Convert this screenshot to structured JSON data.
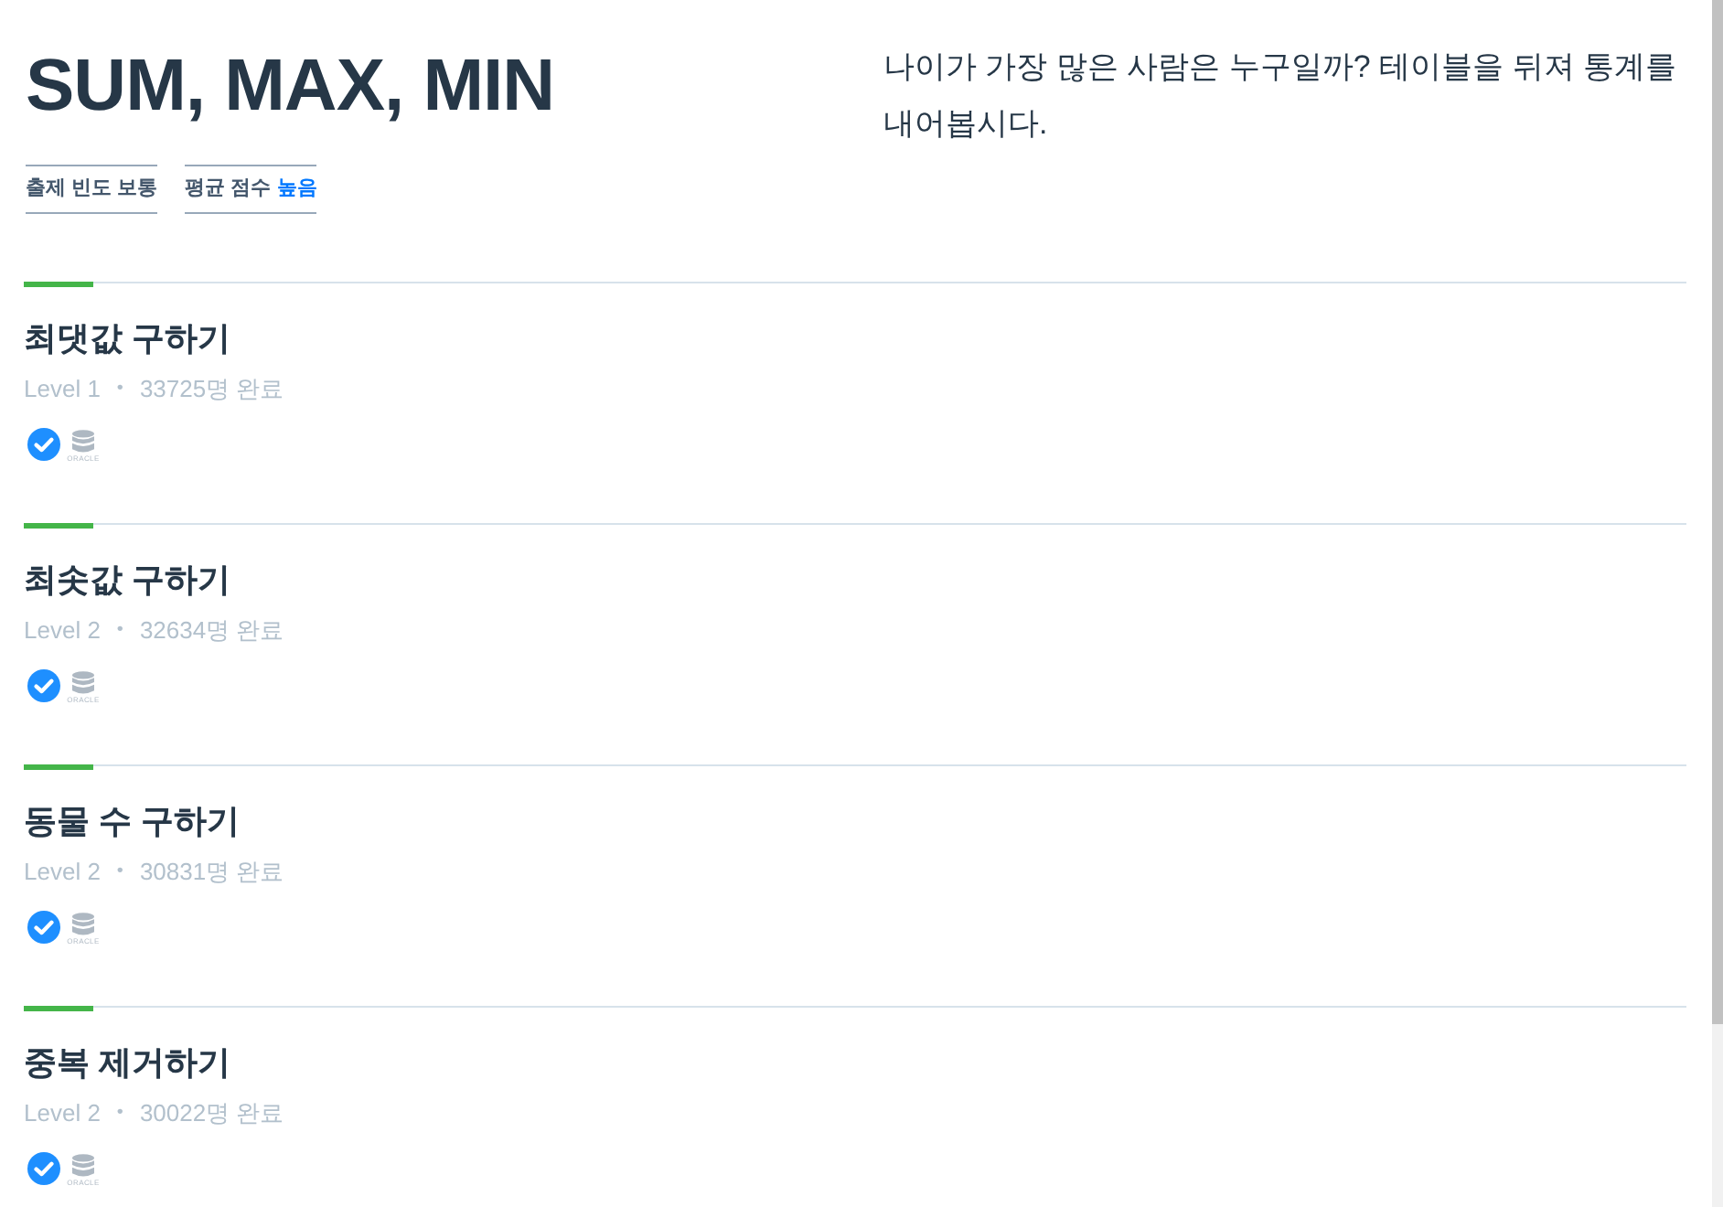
{
  "header": {
    "title": "SUM, MAX, MIN",
    "tags": [
      {
        "label": "출제 빈도",
        "value": "보통",
        "highlight": false
      },
      {
        "label": "평균 점수",
        "value": "높음",
        "highlight": true
      }
    ],
    "description": "나이가 가장 많은 사람은 누구일까? 테이블을 뒤져 통계를 내어봅시다."
  },
  "problems": [
    {
      "title": "최댓값 구하기",
      "level": "Level 1",
      "separator": "•",
      "completed": "33725명 완료",
      "solved": true,
      "db_label": "ORACLE"
    },
    {
      "title": "최솟값 구하기",
      "level": "Level 2",
      "separator": "•",
      "completed": "32634명 완료",
      "solved": true,
      "db_label": "ORACLE"
    },
    {
      "title": "동물 수 구하기",
      "level": "Level 2",
      "separator": "•",
      "completed": "30831명 완료",
      "solved": true,
      "db_label": "ORACLE"
    },
    {
      "title": "중복 제거하기",
      "level": "Level 2",
      "separator": "•",
      "completed": "30022명 완료",
      "solved": true,
      "db_label": "ORACLE"
    }
  ]
}
